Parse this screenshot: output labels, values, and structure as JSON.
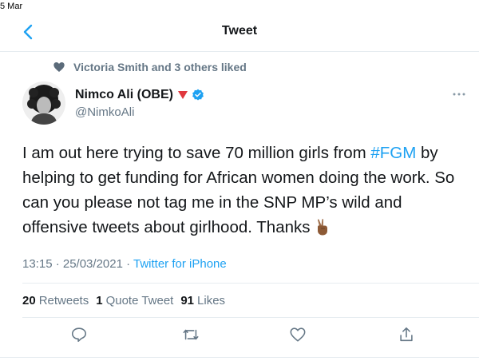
{
  "status": {
    "time": "5 Mar"
  },
  "nav": {
    "title": "Tweet"
  },
  "social_context": {
    "text": "Victoria Smith and 3 others liked"
  },
  "author": {
    "name": "Nimco Ali (OBE)",
    "handle": "@NimkoAli"
  },
  "tweet": {
    "text_before": "I am out here trying to save 70 million girls from ",
    "hashtag": "#FGM",
    "text_after": " by helping to get funding for African women doing the work. So can you please not tag me in the SNP MP’s wild and offensive tweets about girlhood. Thanks ",
    "emoji": "victory-hand-emoji"
  },
  "meta": {
    "timestamp": "13:15 · 25/03/2021 · ",
    "source": "Twitter for iPhone"
  },
  "stats": {
    "retweets_count": "20",
    "retweets_label": "Retweets",
    "quotes_count": "1",
    "quotes_label": "Quote Tweet",
    "likes_count": "91",
    "likes_label": "Likes"
  },
  "icons": [
    "back-chevron-icon",
    "heart-icon",
    "verified-badge-icon",
    "red-triangle-icon",
    "more-icon",
    "reply-icon",
    "retweet-icon",
    "like-icon",
    "share-icon"
  ],
  "colors": {
    "accent": "#1da1f2",
    "muted": "#657786",
    "text": "#14171a"
  }
}
